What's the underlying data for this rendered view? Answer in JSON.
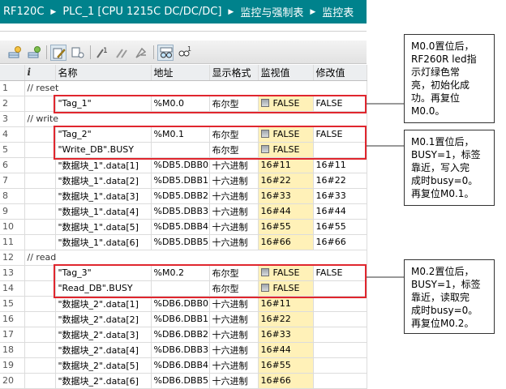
{
  "titlebar": {
    "breadcrumb": [
      "RF120C",
      "PLC_1 [CPU 1215C DC/DC/DC]",
      "监控与强制表",
      "监控表"
    ],
    "background": "#00828c"
  },
  "toolbar": {
    "icons": [
      "add-row-icon",
      "insert-row-icon",
      "edit-icon",
      "display-icon",
      "monitor-once-icon",
      "modify-icon",
      "force-icon",
      "glasses-icon",
      "glasses-once-icon"
    ]
  },
  "table": {
    "headers": [
      "",
      "i",
      "名称",
      "地址",
      "显示格式",
      "监视值",
      "修改值"
    ],
    "rows": [
      {
        "n": "1",
        "comment": "// reset"
      },
      {
        "n": "2",
        "name": "\"Tag_1\"",
        "addr": "%M0.0",
        "fmt": "布尔型",
        "mon": "FALSE",
        "bool": true,
        "mod": "FALSE"
      },
      {
        "n": "3",
        "comment": "// write"
      },
      {
        "n": "4",
        "name": "\"Tag_2\"",
        "addr": "%M0.1",
        "fmt": "布尔型",
        "mon": "FALSE",
        "bool": true,
        "mod": "FALSE"
      },
      {
        "n": "5",
        "name": "\"Write_DB\".BUSY",
        "addr": "",
        "fmt": "布尔型",
        "mon": "FALSE",
        "bool": true,
        "mod": ""
      },
      {
        "n": "6",
        "name": "\"数据块_1\".data[1]",
        "addr": "%DB5.DBB0",
        "fmt": "十六进制",
        "mon": "16#11",
        "mod": "16#11"
      },
      {
        "n": "7",
        "name": "\"数据块_1\".data[2]",
        "addr": "%DB5.DBB1",
        "fmt": "十六进制",
        "mon": "16#22",
        "mod": "16#22"
      },
      {
        "n": "8",
        "name": "\"数据块_1\".data[3]",
        "addr": "%DB5.DBB2",
        "fmt": "十六进制",
        "mon": "16#33",
        "mod": "16#33"
      },
      {
        "n": "9",
        "name": "\"数据块_1\".data[4]",
        "addr": "%DB5.DBB3",
        "fmt": "十六进制",
        "mon": "16#44",
        "mod": "16#44"
      },
      {
        "n": "10",
        "name": "\"数据块_1\".data[5]",
        "addr": "%DB5.DBB4",
        "fmt": "十六进制",
        "mon": "16#55",
        "mod": "16#55"
      },
      {
        "n": "11",
        "name": "\"数据块_1\".data[6]",
        "addr": "%DB5.DBB5",
        "fmt": "十六进制",
        "mon": "16#66",
        "mod": "16#66"
      },
      {
        "n": "12",
        "comment": "// read"
      },
      {
        "n": "13",
        "name": "\"Tag_3\"",
        "addr": "%M0.2",
        "fmt": "布尔型",
        "mon": "FALSE",
        "bool": true,
        "mod": "FALSE"
      },
      {
        "n": "14",
        "name": "\"Read_DB\".BUSY",
        "addr": "",
        "fmt": "布尔型",
        "mon": "FALSE",
        "bool": true,
        "mod": ""
      },
      {
        "n": "15",
        "name": "\"数据块_2\".data[1]",
        "addr": "%DB6.DBB0",
        "fmt": "十六进制",
        "mon": "16#11",
        "mod": ""
      },
      {
        "n": "16",
        "name": "\"数据块_2\".data[2]",
        "addr": "%DB6.DBB1",
        "fmt": "十六进制",
        "mon": "16#22",
        "mod": ""
      },
      {
        "n": "17",
        "name": "\"数据块_2\".data[3]",
        "addr": "%DB6.DBB2",
        "fmt": "十六进制",
        "mon": "16#33",
        "mod": ""
      },
      {
        "n": "18",
        "name": "\"数据块_2\".data[4]",
        "addr": "%DB6.DBB3",
        "fmt": "十六进制",
        "mon": "16#44",
        "mod": ""
      },
      {
        "n": "19",
        "name": "\"数据块_2\".data[5]",
        "addr": "%DB6.DBB4",
        "fmt": "十六进制",
        "mon": "16#55",
        "mod": ""
      },
      {
        "n": "20",
        "name": "\"数据块_2\".data[6]",
        "addr": "%DB6.DBB5",
        "fmt": "十六进制",
        "mon": "16#66",
        "mod": ""
      }
    ]
  },
  "callouts": [
    {
      "lines": [
        "M0.0置位后，",
        "RF260R led指",
        "示灯绿色常",
        "亮，初始化成",
        "功。再复位",
        "M0.0。"
      ]
    },
    {
      "lines": [
        "M0.1置位后，",
        "BUSY=1，标签",
        "靠近，写入完",
        "成时busy=0。",
        "再复位M0.1。"
      ]
    },
    {
      "lines": [
        "M0.2置位后，",
        "BUSY=1，标签",
        "靠近，读取完",
        "成时busy=0。",
        "再复位M0.2。"
      ]
    }
  ],
  "colors": {
    "highlight": "#e0262e",
    "monitor_bg": "#fff1b8",
    "header_bg": "#eceef0"
  }
}
